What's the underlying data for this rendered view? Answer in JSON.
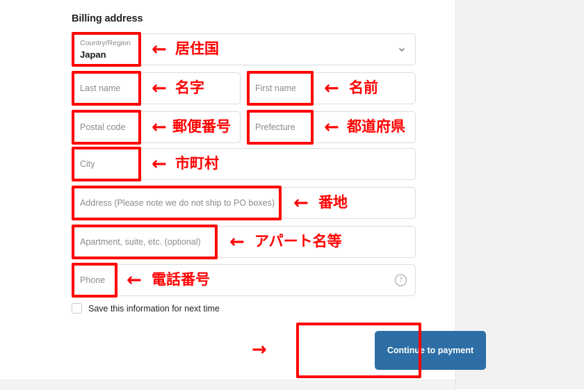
{
  "section": {
    "title": "Billing address"
  },
  "fields": {
    "country": {
      "label": "Country/Region",
      "value": "Japan",
      "chevron_icon": "chevron-down-icon"
    },
    "last_name": {
      "placeholder": "Last name"
    },
    "first_name": {
      "placeholder": "First name"
    },
    "postal_code": {
      "placeholder": "Postal code"
    },
    "prefecture": {
      "placeholder": "Prefecture"
    },
    "city": {
      "placeholder": "City"
    },
    "address": {
      "placeholder": "Address (Please note we do not ship to PO boxes)"
    },
    "apartment": {
      "placeholder": "Apartment, suite, etc. (optional)"
    },
    "phone": {
      "placeholder": "Phone",
      "help_icon": "help-circle-icon"
    }
  },
  "save_info": {
    "label": "Save this information for next time",
    "checked": false
  },
  "cta": {
    "label": "Continue to payment",
    "color": "#2c6ea5"
  },
  "annotations": {
    "arrow_left": "←",
    "arrow_right": "→",
    "color": "#ff0000",
    "labels": {
      "country": "居住国",
      "last_name": "名字",
      "first_name": "名前",
      "postal_code": "郵便番号",
      "prefecture": "都道府県",
      "city": "市町村",
      "address": "番地",
      "apartment": "アパート名等",
      "phone": "電話番号"
    }
  }
}
